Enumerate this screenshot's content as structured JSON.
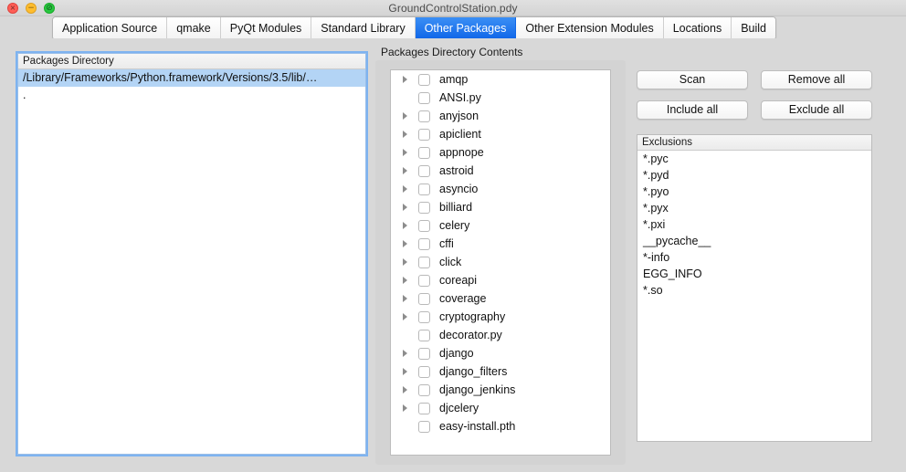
{
  "window": {
    "title": "GroundControlStation.pdy",
    "controls": [
      {
        "name": "close",
        "glyph": "×"
      },
      {
        "name": "minimize",
        "glyph": "−"
      },
      {
        "name": "zoom",
        "glyph": "⊘"
      }
    ]
  },
  "tabs": [
    {
      "label": "Application Source",
      "active": false
    },
    {
      "label": "qmake",
      "active": false
    },
    {
      "label": "PyQt Modules",
      "active": false
    },
    {
      "label": "Standard Library",
      "active": false
    },
    {
      "label": "Other Packages",
      "active": true
    },
    {
      "label": "Other Extension Modules",
      "active": false
    },
    {
      "label": "Locations",
      "active": false
    },
    {
      "label": "Build",
      "active": false
    }
  ],
  "packages_directory": {
    "header": "Packages Directory",
    "rows": [
      {
        "text": "/Library/Frameworks/Python.framework/Versions/3.5/lib/…",
        "selected": true
      },
      {
        "text": ".",
        "selected": false
      }
    ]
  },
  "contents": {
    "label": "Packages Directory Contents",
    "items": [
      {
        "name": "amqp",
        "expandable": true,
        "checked": false
      },
      {
        "name": "ANSI.py",
        "expandable": false,
        "checked": false
      },
      {
        "name": "anyjson",
        "expandable": true,
        "checked": false
      },
      {
        "name": "apiclient",
        "expandable": true,
        "checked": false
      },
      {
        "name": "appnope",
        "expandable": true,
        "checked": false
      },
      {
        "name": "astroid",
        "expandable": true,
        "checked": false
      },
      {
        "name": "asyncio",
        "expandable": true,
        "checked": false
      },
      {
        "name": "billiard",
        "expandable": true,
        "checked": false
      },
      {
        "name": "celery",
        "expandable": true,
        "checked": false
      },
      {
        "name": "cffi",
        "expandable": true,
        "checked": false
      },
      {
        "name": "click",
        "expandable": true,
        "checked": false
      },
      {
        "name": "coreapi",
        "expandable": true,
        "checked": false
      },
      {
        "name": "coverage",
        "expandable": true,
        "checked": false
      },
      {
        "name": "cryptography",
        "expandable": true,
        "checked": false
      },
      {
        "name": "decorator.py",
        "expandable": false,
        "checked": false
      },
      {
        "name": "django",
        "expandable": true,
        "checked": false
      },
      {
        "name": "django_filters",
        "expandable": true,
        "checked": false
      },
      {
        "name": "django_jenkins",
        "expandable": true,
        "checked": false
      },
      {
        "name": "djcelery",
        "expandable": true,
        "checked": false
      },
      {
        "name": "easy-install.pth",
        "expandable": false,
        "checked": false
      }
    ]
  },
  "actions": [
    {
      "label": "Scan"
    },
    {
      "label": "Remove all"
    },
    {
      "label": "Include all"
    },
    {
      "label": "Exclude all"
    }
  ],
  "exclusions": {
    "header": "Exclusions",
    "items": [
      "*.pyc",
      "*.pyd",
      "*.pyo",
      "*.pyx",
      "*.pxi",
      "__pycache__",
      "*-info",
      "EGG_INFO",
      "*.so"
    ]
  },
  "colors": {
    "accent": "#0f66e8",
    "selection": "#b3d4f5",
    "focus_ring": "#7eb3f0",
    "window_bg": "#d8d8d8"
  }
}
